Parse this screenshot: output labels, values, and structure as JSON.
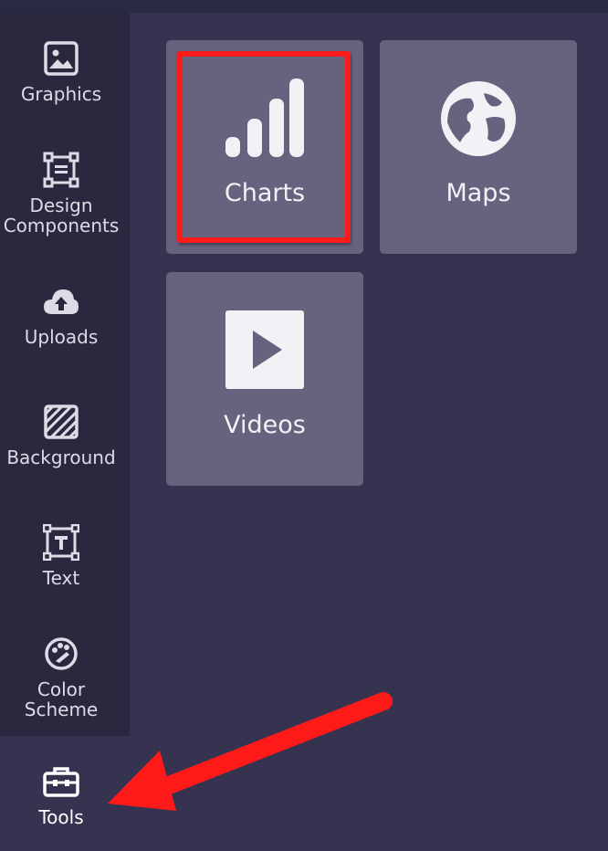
{
  "sidebar": {
    "items": [
      {
        "label": "Graphics",
        "icon": "image-icon"
      },
      {
        "label": "Design\nComponents",
        "icon": "components-icon"
      },
      {
        "label": "Uploads",
        "icon": "cloud-upload-icon"
      },
      {
        "label": "Background",
        "icon": "background-pattern-icon"
      },
      {
        "label": "Text",
        "icon": "text-icon"
      },
      {
        "label": "Color\nScheme",
        "icon": "palette-icon"
      },
      {
        "label": "Tools",
        "icon": "toolbox-icon"
      }
    ],
    "active": "Tools"
  },
  "tiles": [
    {
      "label": "Charts",
      "icon": "bar-chart-icon"
    },
    {
      "label": "Maps",
      "icon": "globe-icon"
    },
    {
      "label": "Videos",
      "icon": "play-icon"
    }
  ],
  "colors": {
    "background": "#35334f",
    "sidebar": "#29283f",
    "tile": "#66637f",
    "annotation": "#ff1a1a"
  }
}
